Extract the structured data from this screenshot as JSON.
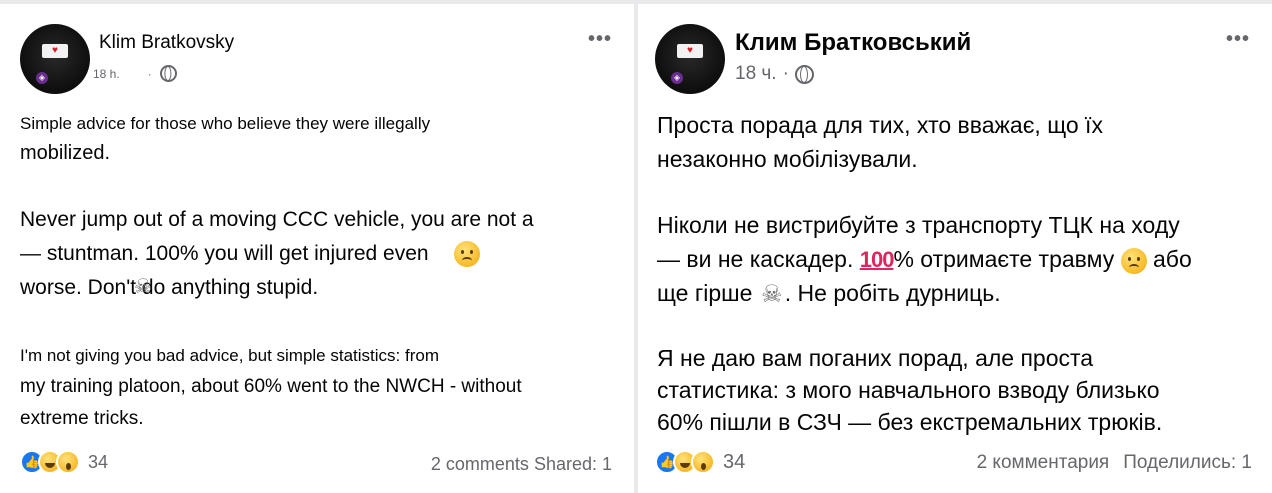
{
  "left_post": {
    "author": "Klim Bratkovsky",
    "time": "18 h.",
    "separator": "·",
    "lines": [
      "Simple advice for those who believe they were illegally",
      "mobilized.",
      "",
      "Never jump out of a moving CCC vehicle, you are not a",
      "— stuntman. 100% you will get injured even",
      "worse. Don't do anything stupid.",
      "",
      "I'm not giving you bad advice, but simple statistics: from",
      "my training platoon, about 60% went to the NWCH - without",
      "extreme tricks."
    ],
    "reaction_count": "34",
    "comments": "2 comments",
    "shared": "Shared: 1"
  },
  "right_post": {
    "author": "Клим Братковський",
    "time": "18 ч.",
    "separator": "·",
    "line1": "Проста порада для тих, хто вважає, що їх",
    "line2": "незаконно мобілізували.",
    "line3": "Ніколи не вистрибуйте з транспорту ТЦК на ходу",
    "line4_a": "— ви не каскадер. ",
    "line4_b": "% отримаєте травму ",
    "line4_c": " або",
    "line5_a": "ще гірше ",
    "line5_b": ". Не робіть дурниць.",
    "line6": "Я не даю вам поганих порад, але проста",
    "line7": "статистика: з мого навчального взводу близько",
    "line8": "60% пішли в СЗЧ — без екстремальних трюків.",
    "reaction_count": "34",
    "comments": "2 комментария",
    "shared": "Поделились: 1"
  },
  "icons": {
    "more": "more-options-icon",
    "globe": "globe-icon",
    "like": "like-reaction-icon",
    "haha": "haha-reaction-icon",
    "wow": "wow-reaction-icon",
    "worried": "worried-face-icon",
    "skull": "skull-crossbones-icon",
    "hundred": "hundred-points-icon"
  },
  "colors": {
    "background": "#e9e9ec",
    "card": "#ffffff",
    "text": "#050505",
    "secondary": "#65676b",
    "like_blue": "#1877f2"
  }
}
